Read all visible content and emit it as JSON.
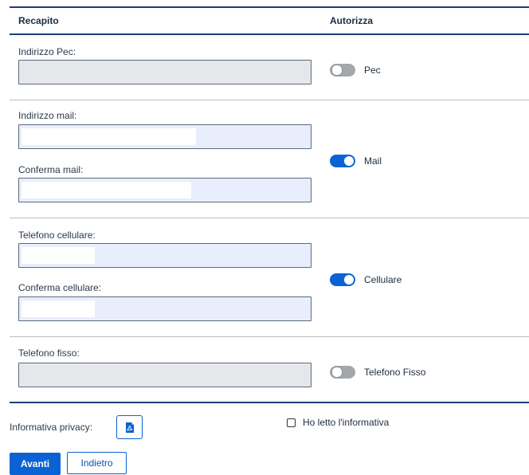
{
  "header": {
    "recapito": "Recapito",
    "autorizza": "Autorizza"
  },
  "pec": {
    "label": "Indirizzo Pec:",
    "toggle_label": "Pec",
    "toggle_state": "off"
  },
  "mail": {
    "label": "Indirizzo mail:",
    "confirm_label": "Conferma mail:",
    "toggle_label": "Mail",
    "toggle_state": "on"
  },
  "cellulare": {
    "label": "Telefono cellulare:",
    "confirm_label": "Conferma cellulare:",
    "toggle_label": "Cellulare",
    "toggle_state": "on"
  },
  "fisso": {
    "label": "Telefono fisso:",
    "toggle_label": "Telefono Fisso",
    "toggle_state": "off"
  },
  "privacy": {
    "label": "Informativa privacy:",
    "pdf_icon": "pdf-icon",
    "checkbox_label": "Ho letto l'informativa",
    "checked": false
  },
  "actions": {
    "primary": "Avanti",
    "secondary": "Indietro"
  },
  "colors": {
    "accent": "#0b62d4",
    "toggle_off": "#a3a6ab",
    "input_disabled": "#e6e7ea",
    "input_active": "#e8eefb"
  }
}
